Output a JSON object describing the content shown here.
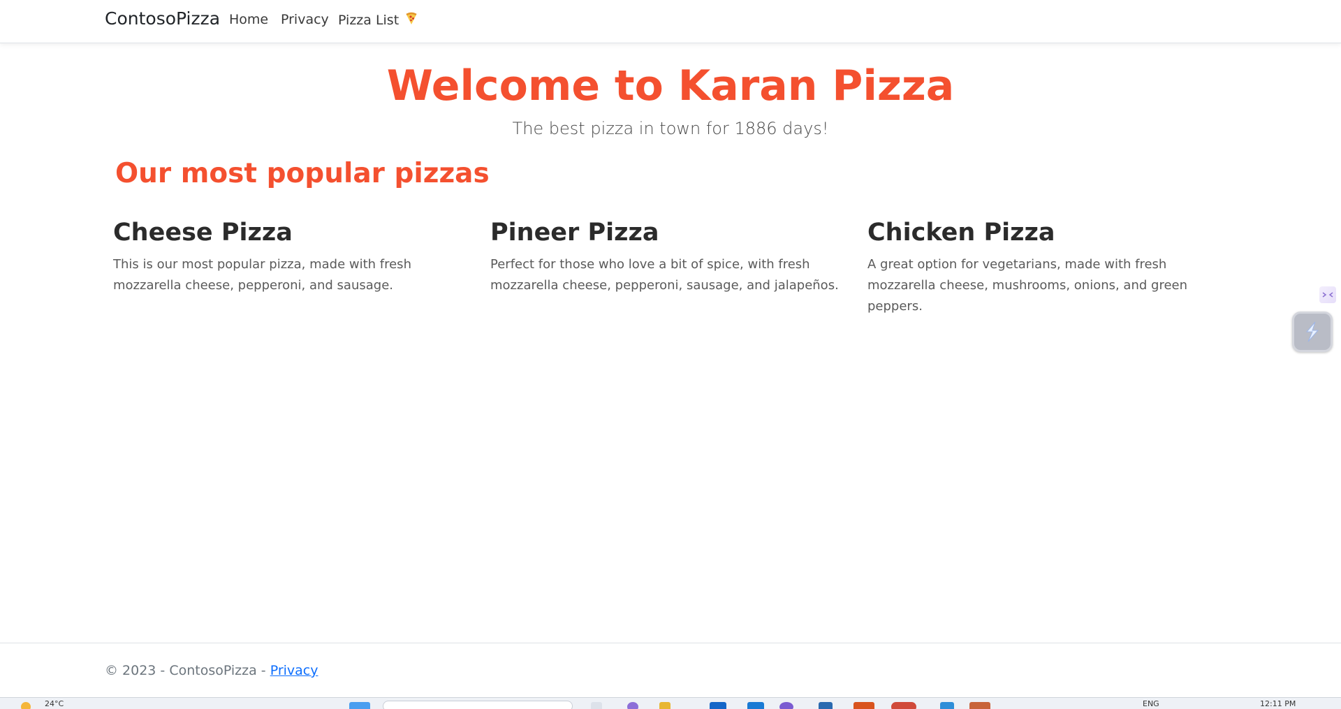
{
  "navbar": {
    "brand": "ContosoPizza",
    "links": [
      "Home",
      "Privacy",
      "Pizza List"
    ],
    "pizza_list_icon": "pizza-slice-icon"
  },
  "hero": {
    "title": "Welcome to Karan Pizza",
    "subtitle": "The best pizza in town for 1886 days!"
  },
  "section": {
    "title": "Our most popular pizzas"
  },
  "pizzas": [
    {
      "name": "Cheese Pizza",
      "description": "This is our most popular pizza, made with fresh mozzarella cheese, pepperoni, and sausage."
    },
    {
      "name": "Pineer Pizza",
      "description": "Perfect for those who love a bit of spice, with fresh mozzarella cheese, pepperoni, sausage, and jalapeños."
    },
    {
      "name": "Chicken Pizza",
      "description": "A great option for vegetarians, made with fresh mozzarella cheese, mushrooms, onions, and green peppers."
    }
  ],
  "footer": {
    "copyright": "© 2023 - ContosoPizza - ",
    "privacy_link": "Privacy"
  },
  "taskbar": {
    "temperature": "24°C",
    "language": "ENG",
    "time": "12:11 PM"
  },
  "colors": {
    "accent": "#f4502f",
    "link": "#0d6efd",
    "text": "#212529",
    "muted": "#6c757d"
  }
}
